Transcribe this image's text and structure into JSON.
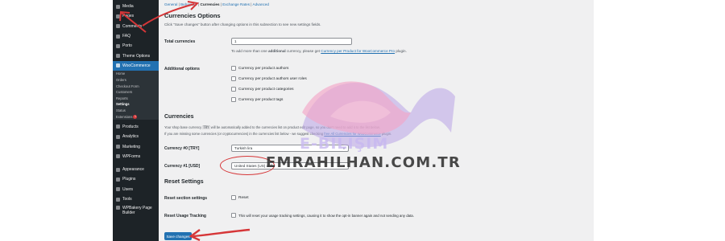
{
  "sidebar": {
    "items": [
      {
        "label": "Media",
        "icon": "media-icon"
      },
      {
        "label": "Pages",
        "icon": "pages-icon"
      },
      {
        "label": "Comments",
        "icon": "comments-icon"
      },
      {
        "label": "FAQ",
        "icon": "faq-icon"
      },
      {
        "label": "Porto",
        "icon": "porto-icon"
      },
      {
        "label": "Theme Options",
        "icon": "theme-options-icon"
      },
      {
        "label": "WooCommerce",
        "icon": "woocommerce-icon"
      }
    ],
    "sub_items": [
      "Home",
      "Orders",
      "Checkout Form",
      "Customers",
      "Reports",
      "Settings",
      "Status",
      "Extensions"
    ],
    "extensions_badge": "1",
    "lower_items": [
      {
        "label": "Products",
        "icon": "products-icon"
      },
      {
        "label": "Analytics",
        "icon": "analytics-icon"
      },
      {
        "label": "Marketing",
        "icon": "marketing-icon"
      },
      {
        "label": "WPForms",
        "icon": "wpforms-icon"
      },
      {
        "label": "Appearance",
        "icon": "appearance-icon"
      },
      {
        "label": "Plugins",
        "icon": "plugins-icon"
      },
      {
        "label": "Users",
        "icon": "users-icon"
      },
      {
        "label": "Tools",
        "icon": "tools-icon"
      },
      {
        "label": "WPBakery Page",
        "icon": "wpbakery-icon"
      }
    ],
    "wpbakery_line2": "Builder"
  },
  "subnav": {
    "general": "General",
    "sep1": " | ",
    "behaviour": "Behaviour",
    "sep2": " | ",
    "currencies": "Currencies",
    "sep3": " | ",
    "exchange_rates": "Exchange Rates",
    "sep4": " | ",
    "advanced": "Advanced"
  },
  "section_currencies_options": {
    "title": "Currencies Options",
    "note": "Click \"Save changes\" button after changing options in this subsection to see new settings fields.",
    "total_label": "Total currencies",
    "total_value": "1",
    "total_note_pre": "To add more than one ",
    "total_note_bold": "additional",
    "total_note_mid": " currency, please get ",
    "total_note_link": "Currency per Product for WooCommerce Pro",
    "total_note_post": " plugin.",
    "additional_label": "Additional options",
    "checkboxes": [
      "Currency per product authors",
      "Currency per product authors user roles",
      "Currency per product categories",
      "Currency per product tags"
    ]
  },
  "section_currencies": {
    "title": "Currencies",
    "line1_pre": "Your shop base currency ",
    "line1_code": "TRY",
    "line1_post": " will be automatically added to the currencies list on product edit page, so you don't need to add it to the list below.",
    "line2_pre": "If you are missing some currencies (or cryptocurrencies) in the currencies list below - we suggest checking ",
    "line2_link": "free All Currencies for WooCommerce",
    "line2_post": " plugin.",
    "currency0_label": "Currency #0 [TRY]",
    "currency0_value": "Turkish lira",
    "currency1_label": "Currency #1 [USD]",
    "currency1_value": "United States (US) dollar"
  },
  "section_reset": {
    "title": "Reset Settings",
    "reset_label": "Reset section settings",
    "reset_cb": "Reset",
    "tracking_label": "Reset Usage Tracking",
    "tracking_cb": "This will reset your usage tracking settings, causing it to show the opt-in banner again and not sending any data."
  },
  "save_button": "Save changes",
  "watermark": {
    "brand": "E-BILIŞIM",
    "site": "EMRAHILHAN.COM.TR"
  },
  "colors": {
    "sidebar_bg": "#1d2327",
    "accent": "#2271b1",
    "annotation_red": "#d63638"
  }
}
